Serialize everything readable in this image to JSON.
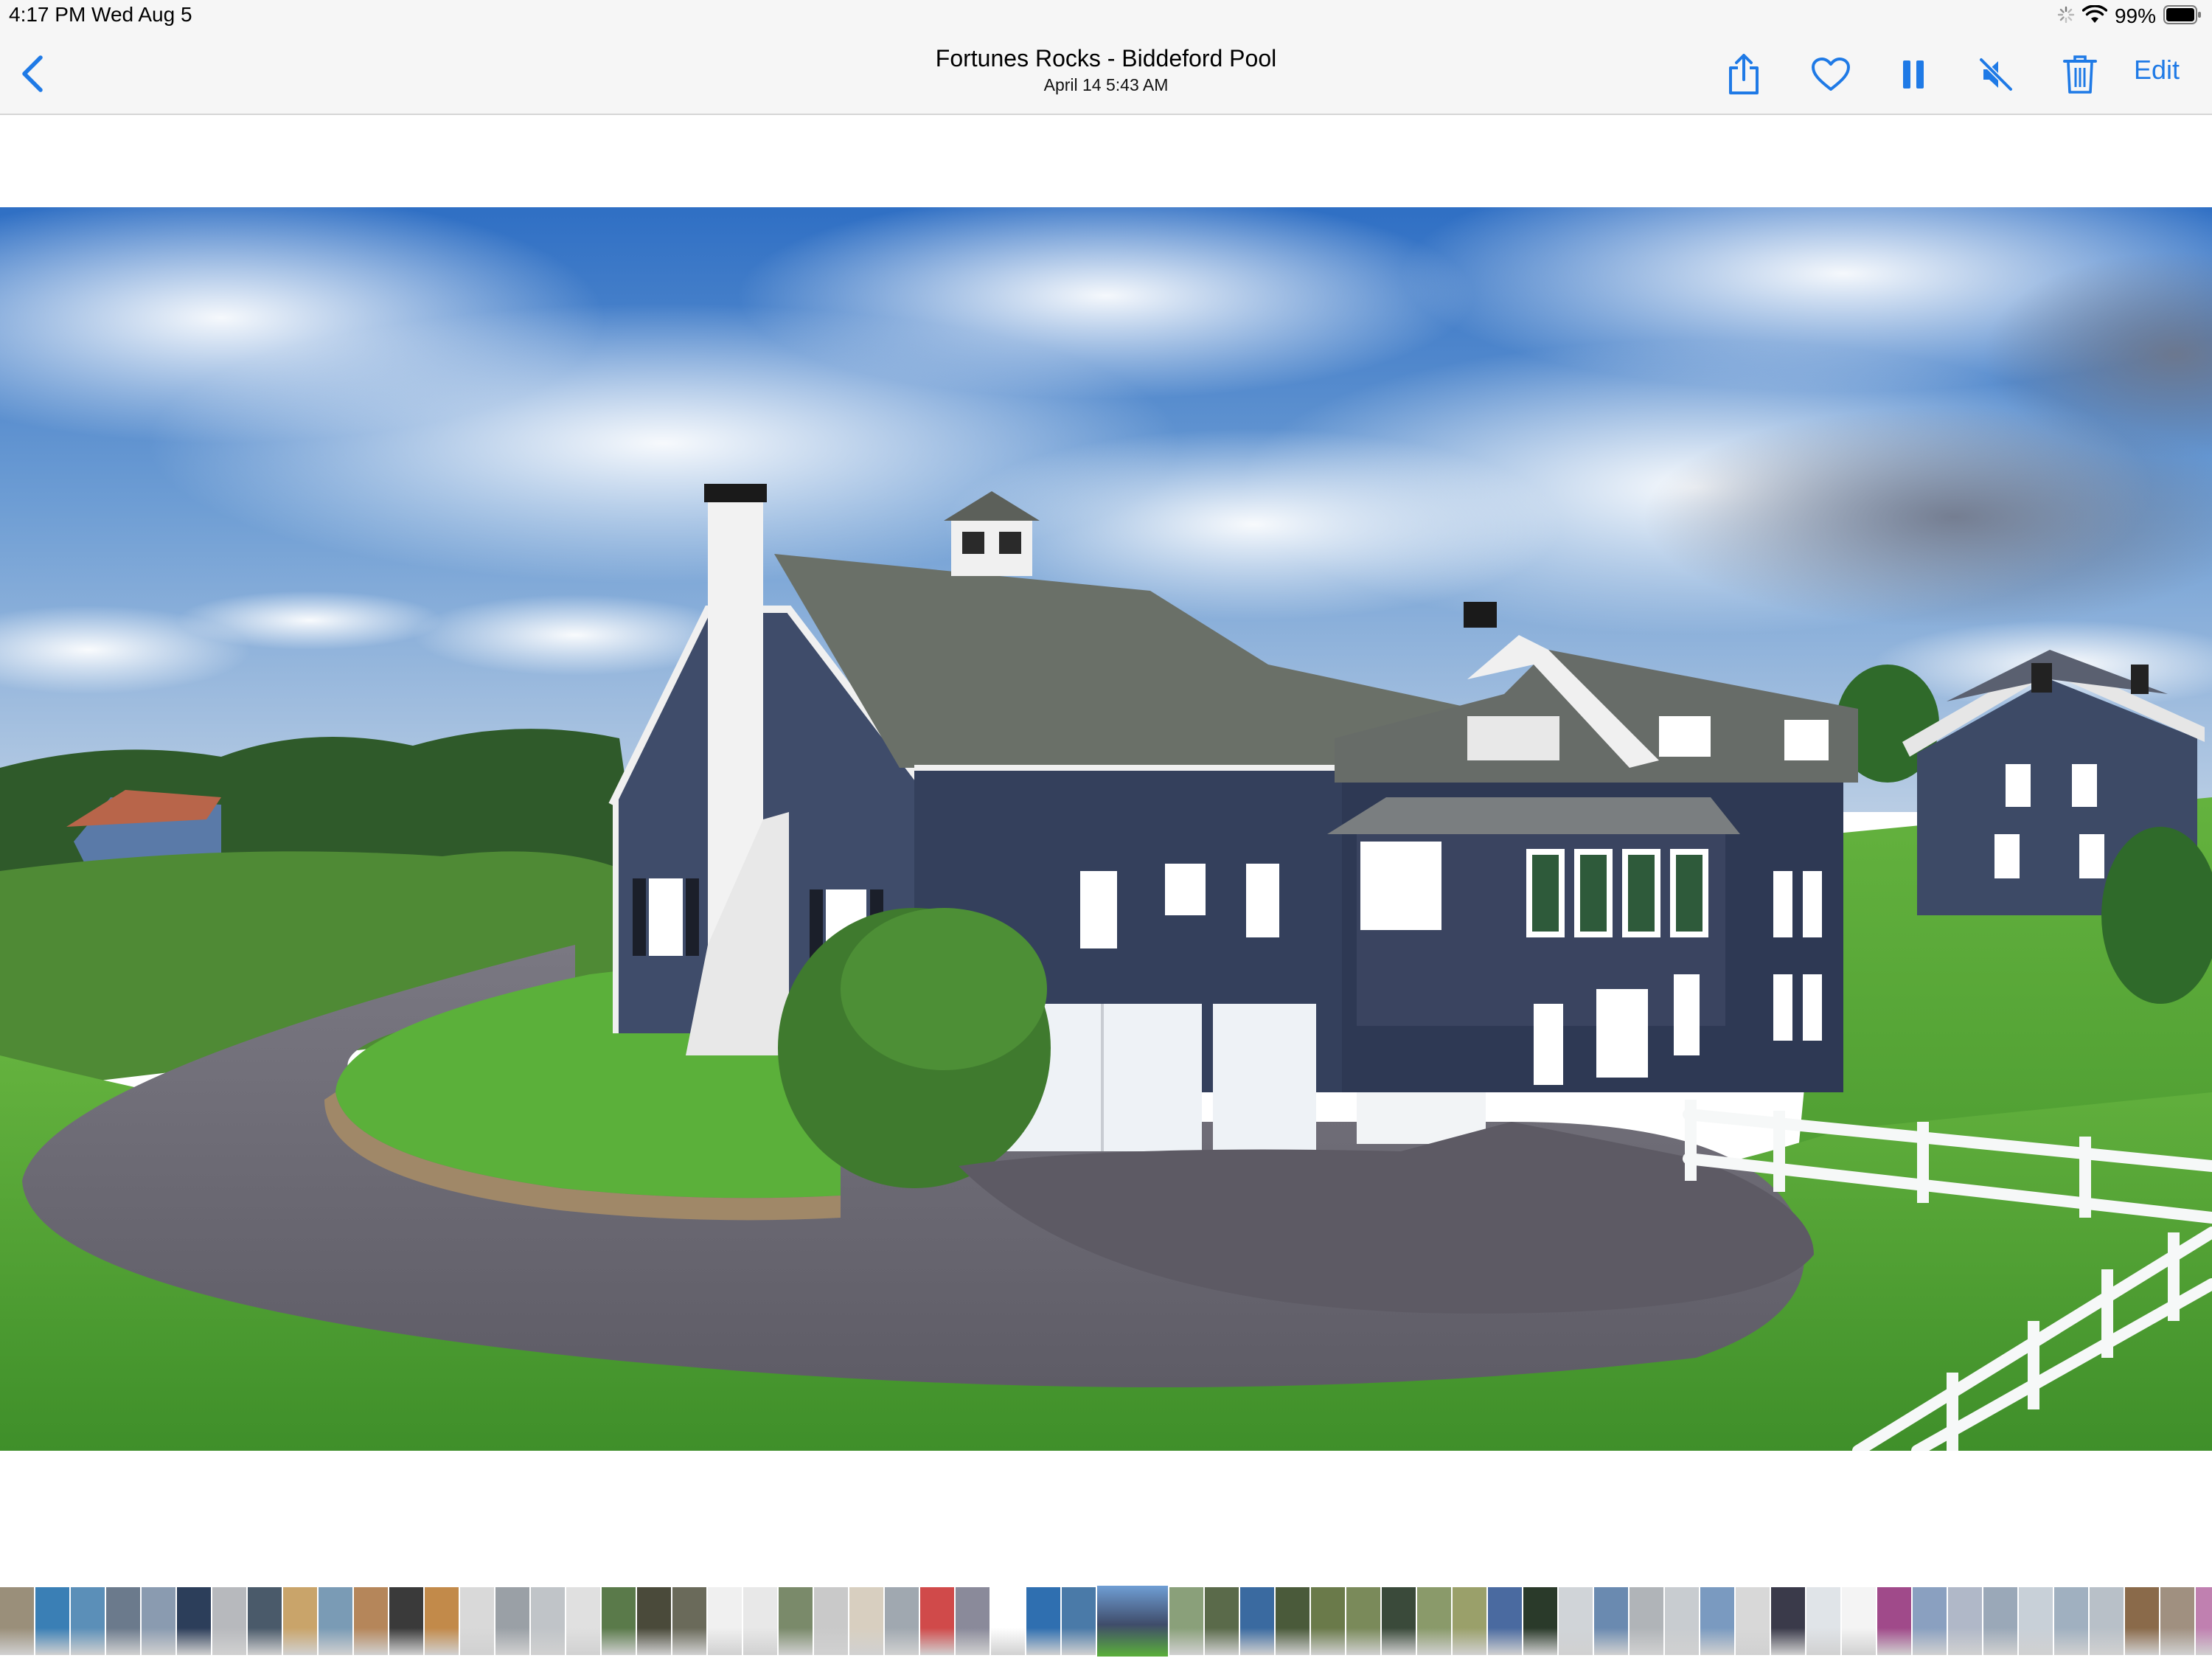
{
  "status_bar": {
    "time": "4:17 PM   Wed Aug 5",
    "battery_percent": "99%"
  },
  "nav": {
    "title": "Fortunes Rocks - Biddeford Pool",
    "subtitle": "April 14  5:43 AM",
    "edit_label": "Edit",
    "icons": [
      "chevron-left-icon",
      "share-icon",
      "heart-icon",
      "pause-icon",
      "speaker-muted-icon",
      "trash-icon"
    ]
  },
  "colors": {
    "accent": "#1f7ae6",
    "bar_background": "#f6f6f6",
    "house_siding": "#3d4a66",
    "lawn": "#5aa83a",
    "sky": "#3f7fcf"
  },
  "filmstrip": {
    "thumbnails": [
      "#9a8f7a",
      "#3a7fb5",
      "#5b8fb8",
      "#6b7a8c",
      "#8a9bb0",
      "#2c3e5a",
      "#b7b9bd",
      "#4a5a6a",
      "#c9a46a",
      "#7a9bb5",
      "#b5865a",
      "#3a3a3a",
      "#c28a4a",
      "#d9d9d9",
      "#9aa0a6",
      "#c0c4c8",
      "#e0e0e0",
      "#5a7a4a",
      "#4a4a3a",
      "#6a6a5a",
      "#f0f0f0",
      "#e8e8e8",
      "#7a8a6a",
      "#c9c9c9",
      "#d8cfc0",
      "#a0a8b0",
      "#d04a4a",
      "#8a8a9a",
      "#ffffff",
      "#2f6fb0",
      "#4a7aa8",
      "#ffffff",
      "#8aa07a",
      "#5a6a4a",
      "#3a6aa0",
      "#4a5a3a",
      "#6a7a4a",
      "#7a8a5a",
      "#3a4a3a",
      "#8a9a6a",
      "#9aa06a",
      "#4a6aa0",
      "#2a3a2a",
      "#d0d4d8",
      "#6a8ab0",
      "#b0b4b8",
      "#c8ccd0",
      "#7a9ac0",
      "#d8d8d8",
      "#3a3a4a",
      "#e0e4e8",
      "#f4f4f4",
      "#a04a8a",
      "#8aa0c0",
      "#b0b8c8",
      "#9aa8b8",
      "#c8d0d8",
      "#a0b0c0",
      "#b8c0c8",
      "#8a6a4a",
      "#a09080",
      "#c080b0",
      "#b0b8c0"
    ],
    "current_index": 31
  }
}
